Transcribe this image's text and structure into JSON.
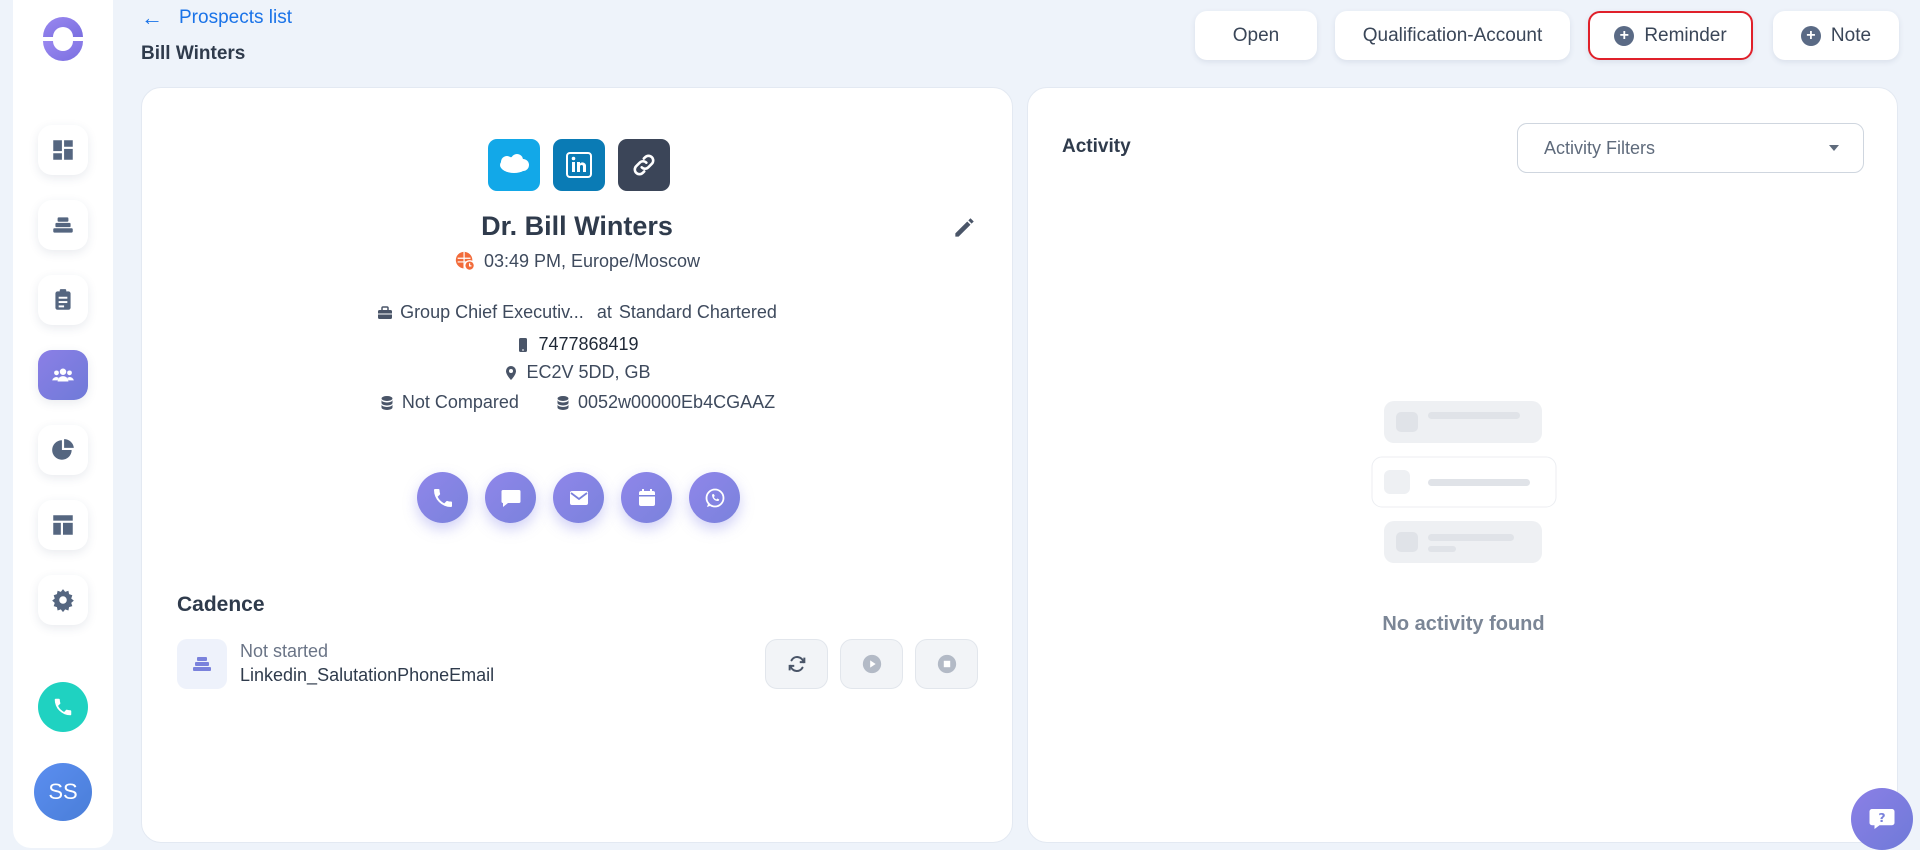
{
  "header": {
    "back_label": "Prospects list",
    "page_title": "Bill Winters",
    "buttons": {
      "open": "Open",
      "qualification": "Qualification-Account",
      "reminder": "Reminder",
      "note": "Note"
    }
  },
  "sidebar": {
    "avatar_initials": "SS",
    "icons": [
      "dashboard-icon",
      "cadence-icon",
      "tasks-icon",
      "prospects-icon",
      "reports-icon",
      "templates-icon",
      "settings-icon"
    ]
  },
  "prospect": {
    "name": "Dr. Bill Winters",
    "local_time": "03:49 PM, Europe/Moscow",
    "job_title": "Group Chief Executiv...",
    "company_connector": "at",
    "company": "Standard Chartered",
    "phone": "7477868419",
    "location": "EC2V 5DD, GB",
    "compare_status": "Not Compared",
    "crm_id": "0052w00000Eb4CGAAZ"
  },
  "cadence": {
    "title": "Cadence",
    "status": "Not started",
    "name": "Linkedin_SalutationPhoneEmail"
  },
  "activity": {
    "title": "Activity",
    "filter_label": "Activity Filters",
    "empty_text": "No activity found"
  },
  "colors": {
    "accent": "#1a73e8",
    "purple": "#7a82dc",
    "reminder_border": "#e0202a",
    "call_green": "#1fd2c1"
  }
}
